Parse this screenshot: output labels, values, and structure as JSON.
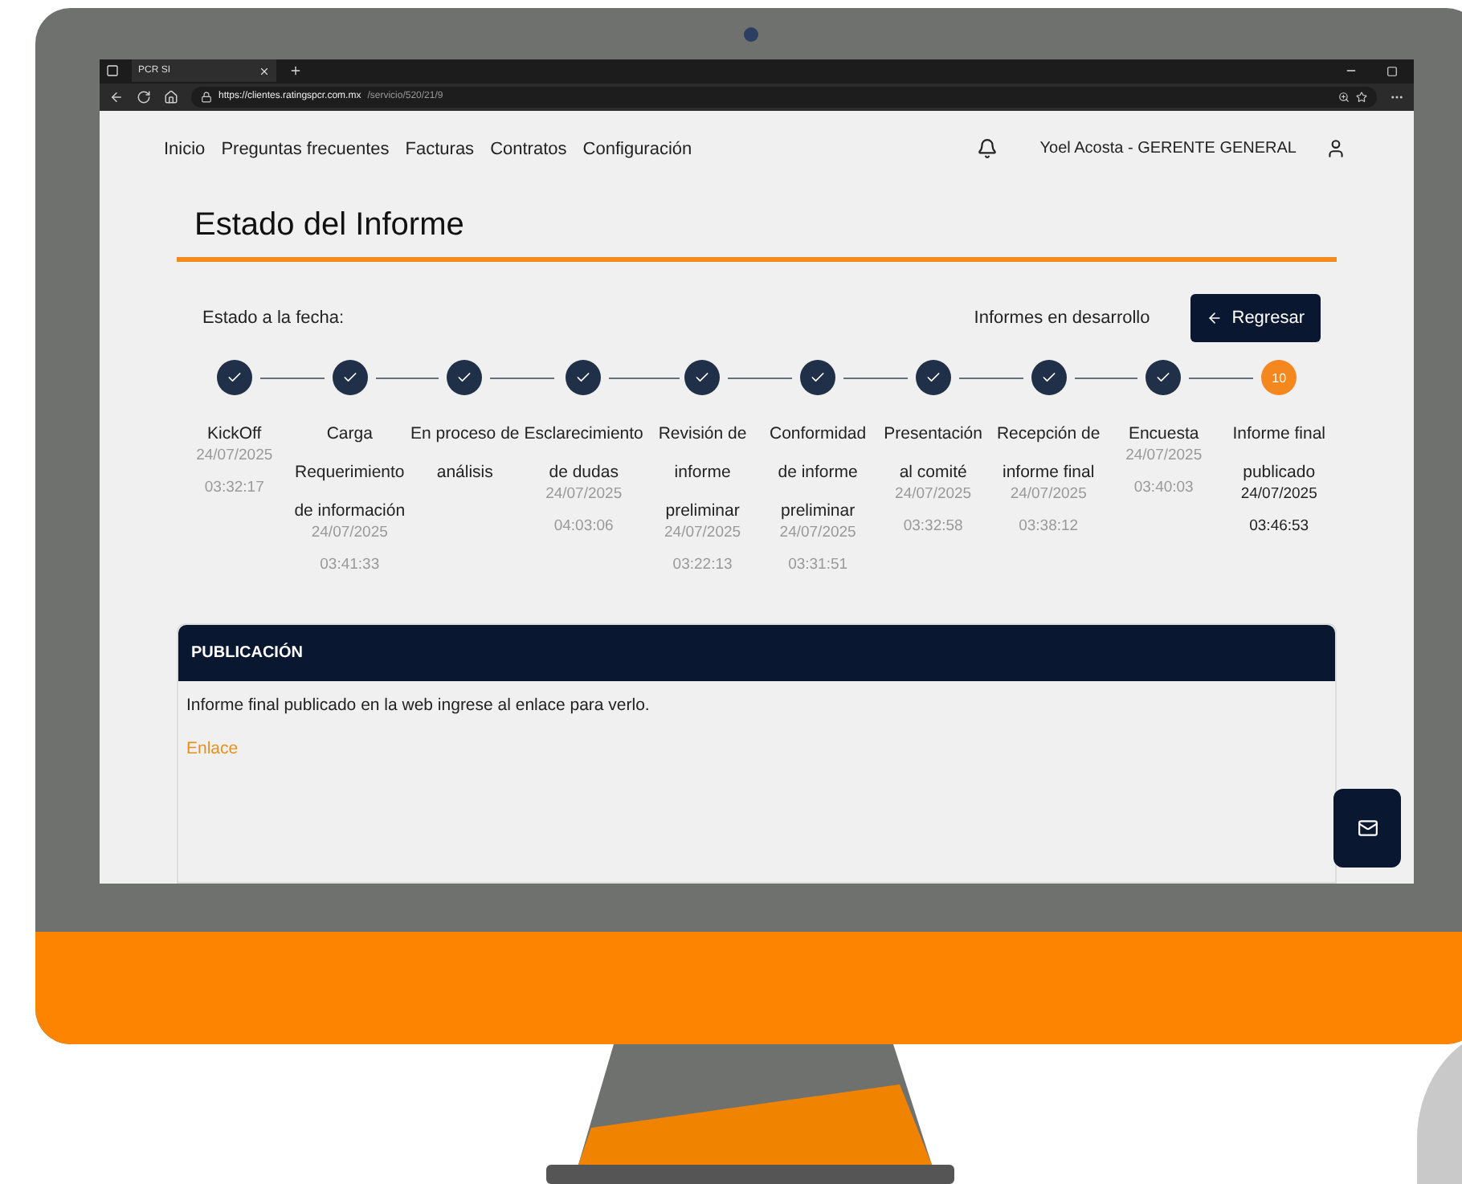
{
  "browser": {
    "tab_title": "PCR SI",
    "url_host": "https://clientes.ratingspcr.com.mx",
    "url_path": "/servicio/520/21/9"
  },
  "nav": {
    "links": [
      "Inicio",
      "Preguntas frecuentes",
      "Facturas",
      "Contratos",
      "Configuración"
    ],
    "user": "Yoel Acosta - GERENTE GENERAL"
  },
  "page": {
    "title": "Estado del Informe",
    "status_label": "Estado a la fecha:",
    "section_label": "Informes en desarrollo",
    "back_button": "Regresar"
  },
  "steps": [
    {
      "label": "KickOff",
      "date": "24/07/2025",
      "time": "03:32:17",
      "completed": true
    },
    {
      "label": "Carga Requerimiento de información",
      "date": "24/07/2025",
      "time": "03:41:33",
      "completed": true
    },
    {
      "label": "En proceso de análisis",
      "completed": true
    },
    {
      "label": "Esclarecimiento de dudas",
      "date": "24/07/2025",
      "time": "04:03:06",
      "completed": true
    },
    {
      "label": "Revisión de informe preliminar",
      "date": "24/07/2025",
      "time": "03:22:13",
      "completed": true
    },
    {
      "label": "Conformidad de informe preliminar",
      "date": "24/07/2025",
      "time": "03:31:51",
      "completed": true
    },
    {
      "label": "Presentación al comité",
      "date": "24/07/2025",
      "time": "03:32:58",
      "completed": true
    },
    {
      "label": "Recepción de informe final",
      "date": "24/07/2025",
      "time": "03:38:12",
      "completed": true
    },
    {
      "label": "Encuesta",
      "date": "24/07/2025",
      "time": "03:40:03",
      "completed": true
    },
    {
      "label": "Informe final publicado",
      "date": "24/07/2025",
      "time": "03:46:53",
      "completed": false,
      "number": "10"
    }
  ],
  "publication": {
    "title": "PUBLICACIÓN",
    "text": "Informe final publicado en la web ingrese al enlace para verlo.",
    "link": "Enlace"
  }
}
